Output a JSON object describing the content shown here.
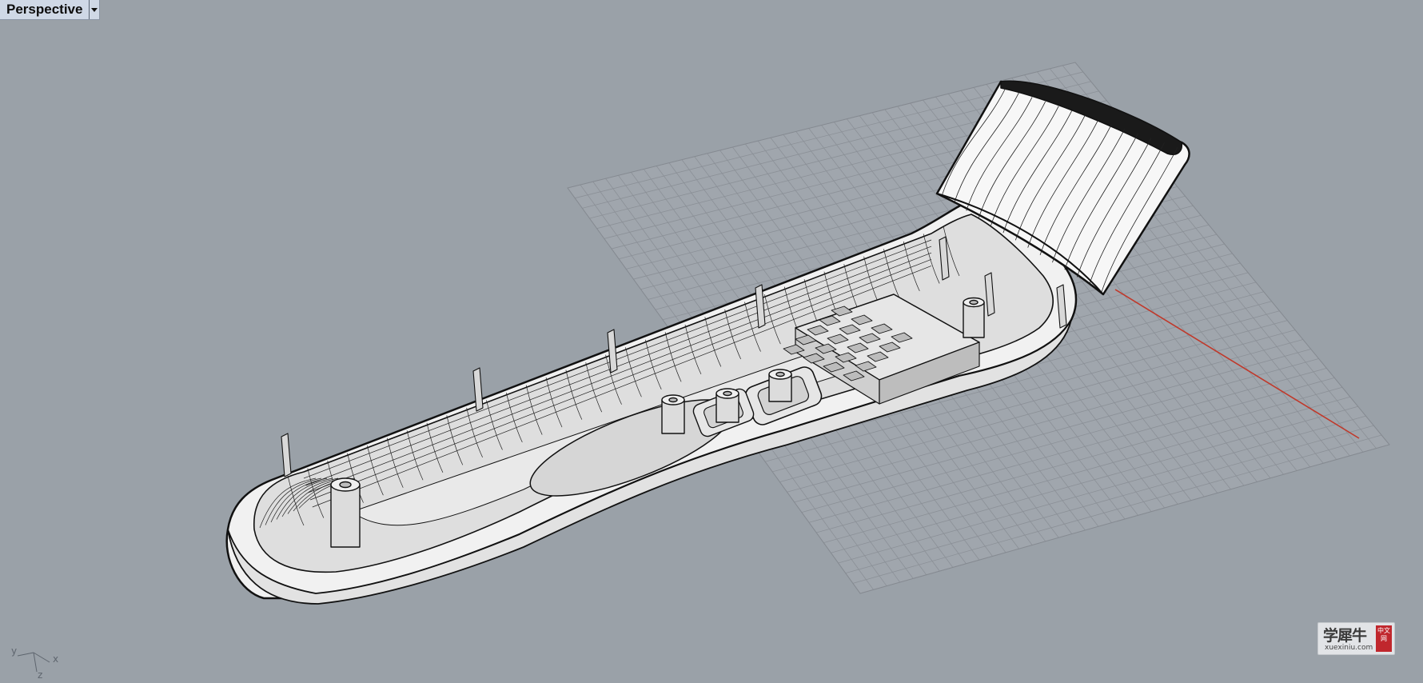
{
  "viewport": {
    "title": "Perspective",
    "menu_icon": "dropdown-arrow-icon",
    "background": "#9aa1a8",
    "grid_color": "#8b9097",
    "x_axis_color": "#c0392b"
  },
  "axes_widget": {
    "x": "x",
    "y": "y",
    "z": "z"
  },
  "watermark": {
    "text": "学犀牛",
    "url": "xuexiniu.com",
    "seal": "中文网",
    "seal_color": "#c0272d"
  }
}
